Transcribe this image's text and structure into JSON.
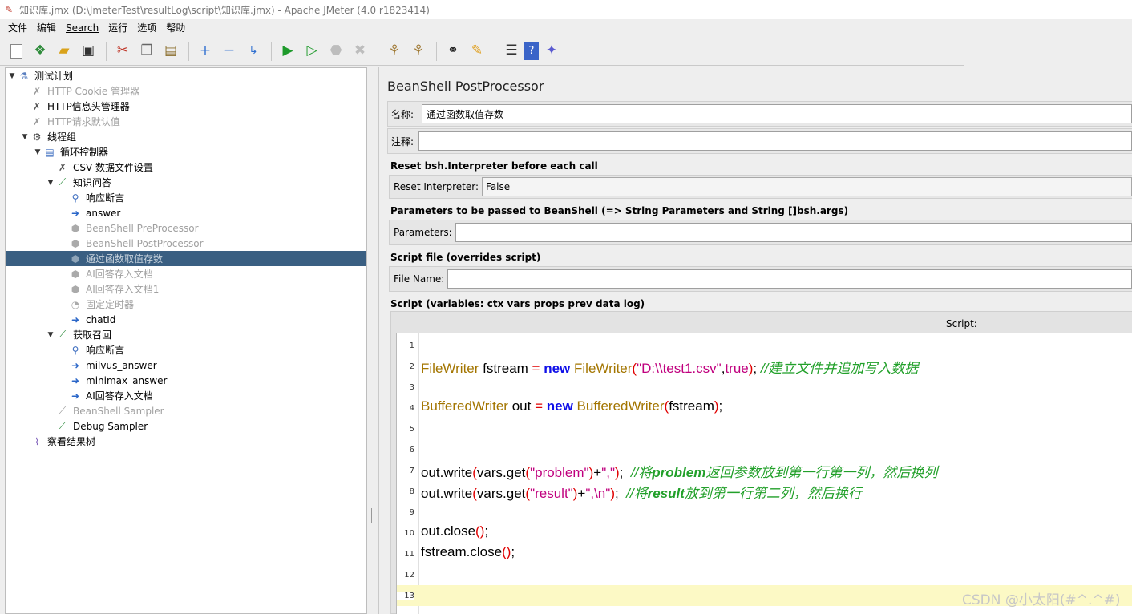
{
  "window": {
    "title": "知识库.jmx (D:\\JmeterTest\\resultLog\\script\\知识库.jmx) - Apache JMeter (4.0 r1823414)"
  },
  "menu": [
    "文件",
    "编辑",
    "Search",
    "运行",
    "选项",
    "帮助"
  ],
  "toolbar": {
    "buttons": [
      "new-icon",
      "templates-icon",
      "open-icon",
      "save-icon",
      "cut-icon",
      "copy-icon",
      "paste-icon",
      "expand-icon",
      "collapse-icon",
      "toggle-icon",
      "start-icon",
      "start-no-pause-icon",
      "stop-icon",
      "shutdown-icon",
      "clear-icon",
      "clear-all-icon",
      "search-icon",
      "reset-search-icon",
      "function-helper-icon",
      "help-icon",
      "remote-icon"
    ]
  },
  "tree": [
    {
      "label": "测试计划",
      "dim": false
    },
    {
      "label": "HTTP Cookie 管理器",
      "dim": true
    },
    {
      "label": "HTTP信息头管理器",
      "dim": false
    },
    {
      "label": "HTTP请求默认值",
      "dim": true
    },
    {
      "label": "线程组",
      "dim": false
    },
    {
      "label": "循环控制器",
      "dim": false
    },
    {
      "label": "CSV 数据文件设置",
      "dim": false
    },
    {
      "label": "知识问答",
      "dim": false
    },
    {
      "label": "响应断言",
      "dim": false
    },
    {
      "label": "answer",
      "dim": false
    },
    {
      "label": "BeanShell PreProcessor",
      "dim": true
    },
    {
      "label": "BeanShell PostProcessor",
      "dim": true
    },
    {
      "label": "通过函数取值存数",
      "dim": true
    },
    {
      "label": "AI回答存入文档",
      "dim": true
    },
    {
      "label": "AI回答存入文档1",
      "dim": true
    },
    {
      "label": "固定定时器",
      "dim": true
    },
    {
      "label": "chatId",
      "dim": false
    },
    {
      "label": "获取召回",
      "dim": false
    },
    {
      "label": "响应断言",
      "dim": false
    },
    {
      "label": "milvus_answer",
      "dim": false
    },
    {
      "label": "minimax_answer",
      "dim": false
    },
    {
      "label": "AI回答存入文档",
      "dim": false
    },
    {
      "label": "BeanShell Sampler",
      "dim": true
    },
    {
      "label": "Debug Sampler",
      "dim": false
    },
    {
      "label": "察看结果树",
      "dim": false
    }
  ],
  "panel": {
    "title": "BeanShell PostProcessor",
    "name_label": "名称:",
    "name_value": "通过函数取值存数",
    "comment_label": "注释:",
    "comment_value": "",
    "reset_section": "Reset bsh.Interpreter before each call",
    "reset_label": "Reset Interpreter:",
    "reset_value": "False",
    "params_section": "Parameters to be passed to BeanShell (=> String Parameters and String []bsh.args)",
    "params_label": "Parameters:",
    "params_value": "",
    "file_section": "Script file (overrides script)",
    "file_label": "File Name:",
    "file_value": "",
    "script_section": "Script (variables: ctx vars props prev data log)",
    "script_label": "Script:"
  },
  "script": {
    "line_numbers": [
      "1",
      "2",
      "3",
      "4",
      "5",
      "6",
      "7",
      "8",
      "9",
      "10",
      "11",
      "12",
      "13"
    ],
    "l2": {
      "type": "FileWriter",
      "var": " fstream ",
      "eq": "=",
      "kw": " new ",
      "ctor": "FileWriter",
      "p1": "(",
      "str": "\"D:\\\\test1.csv\"",
      "comma": ",",
      "kw2": "true",
      "p2": ")",
      "semi": "; ",
      "comment": "//建立文件并追加写入数据"
    },
    "l4": {
      "type": "BufferedWriter",
      "var": " out ",
      "eq": "=",
      "kw": " new ",
      "ctor": "BufferedWriter",
      "p1": "(",
      "arg": "fstream",
      "p2": ")",
      "semi": ";"
    },
    "l7": {
      "a": "out.write",
      "p1": "(",
      "b": "vars.get",
      "p2": "(",
      "s1": "\"problem\"",
      "p3": ")",
      "plus": "+",
      "s2": "\",\"",
      "p4": ")",
      "semi": ";  ",
      "c1": "//将",
      "c2": "problem",
      "c3": "返回参数放到第一行第一列，然后换列"
    },
    "l8": {
      "a": "out.write",
      "p1": "(",
      "b": "vars.get",
      "p2": "(",
      "s1": "\"result\"",
      "p3": ")",
      "plus": "+",
      "s2": "\",\\n\"",
      "p4": ")",
      "semi": ";  ",
      "c1": "//将",
      "c2": "result",
      "c3": "放到第一行第二列，然后换行"
    },
    "l10": {
      "a": "out.close",
      "p": "()",
      "semi": ";"
    },
    "l11": {
      "a": "fstream.close",
      "p": "()",
      "semi": ";"
    }
  },
  "watermark": "CSDN @小太阳(#^.^#)"
}
